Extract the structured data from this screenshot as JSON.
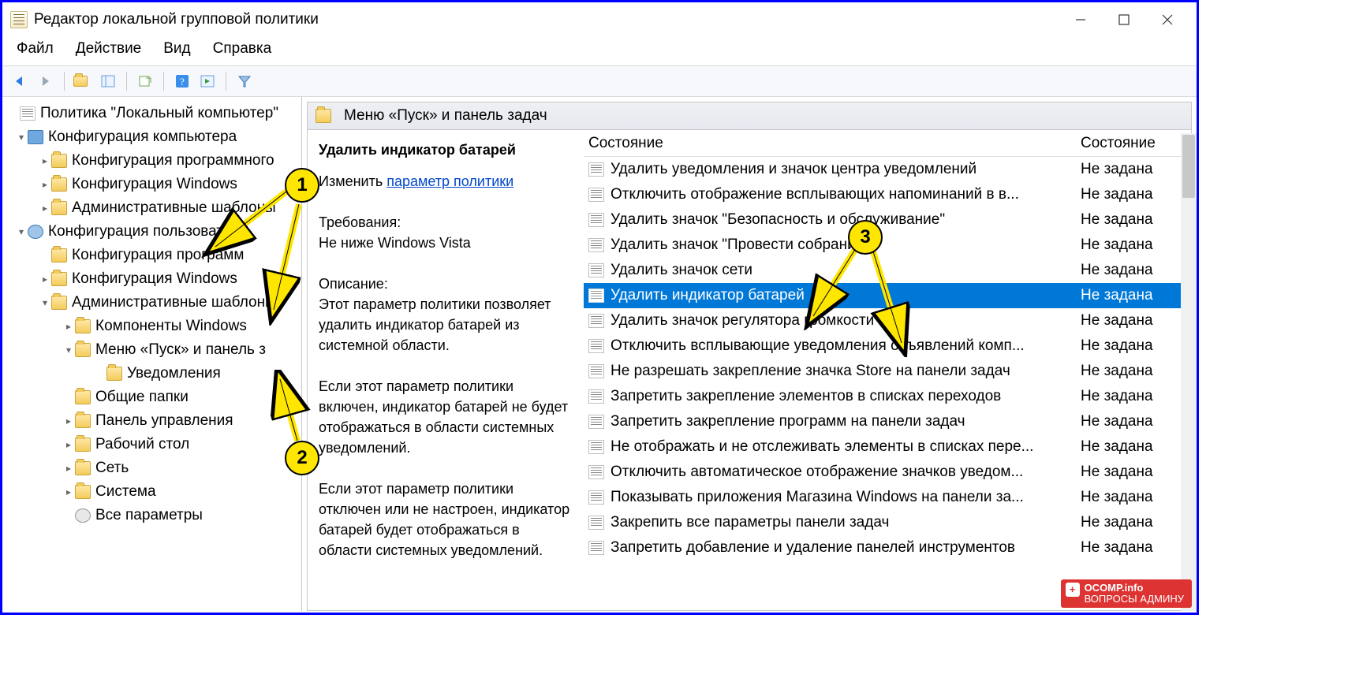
{
  "window": {
    "title": "Редактор локальной групповой политики"
  },
  "menu": {
    "file": "Файл",
    "action": "Действие",
    "view": "Вид",
    "help": "Справка"
  },
  "tree": {
    "root": "Политика \"Локальный компьютер\"",
    "cc": "Конфигурация компьютера",
    "cc_prog": "Конфигурация программного",
    "cc_win": "Конфигурация Windows",
    "cc_adm": "Административные шаблоны",
    "uc": "Конфигурация пользователя",
    "uc_prog": "Конфигурация программ",
    "uc_win": "Конфигурация Windows",
    "uc_adm": "Административные шаблоны",
    "uc_comp": "Компоненты Windows",
    "uc_start": "Меню «Пуск» и панель з",
    "uc_notif": "Уведомления",
    "uc_shared": "Общие папки",
    "uc_cp": "Панель управления",
    "uc_desk": "Рабочий стол",
    "uc_net": "Сеть",
    "uc_sys": "Система",
    "uc_all": "Все параметры"
  },
  "right": {
    "header": "Меню «Пуск» и панель задач",
    "policy_title": "Удалить индикатор батарей",
    "edit_pre": "Изменить ",
    "edit_link": "параметр политики",
    "req_label": "Требования:",
    "req_val": "Не ниже Windows Vista",
    "desc_label": "Описание:",
    "desc1": "Этот параметр политики позволяет удалить индикатор батарей из системной области.",
    "desc2": "Если этот параметр политики включен, индикатор батарей не будет отображаться в области системных уведомлений.",
    "desc3": "Если этот параметр политики отключен или не настроен, индикатор батарей будет отображаться в области системных уведомлений.",
    "col_state": "Состояние",
    "col_state2": "Состояние",
    "default_state": "Не задана",
    "items": [
      "Удалить уведомления и значок центра уведомлений",
      "Отключить отображение всплывающих напоминаний в в...",
      "Удалить значок \"Безопасность и обслуживание\"",
      "Удалить значок \"Провести собрание\"",
      "Удалить значок сети",
      "Удалить индикатор батарей",
      "Удалить значок регулятора громкости",
      "Отключить всплывающие уведомления объявлений комп...",
      "Не разрешать закрепление значка Store на панели задач",
      "Запретить закрепление элементов в списках переходов",
      "Запретить закрепление программ на панели задач",
      "Не отображать и не отслеживать элементы в списках пере...",
      "Отключить автоматическое отображение значков уведом...",
      "Показывать приложения Магазина Windows на панели за...",
      "Закрепить все параметры панели задач",
      "Запретить добавление и удаление панелей инструментов"
    ],
    "selected_index": 5
  },
  "annotations": {
    "b1": "1",
    "b2": "2",
    "b3": "3"
  },
  "watermark": {
    "brand": "OCOMP.info",
    "sub": "ВОПРОСЫ АДМИНУ"
  }
}
